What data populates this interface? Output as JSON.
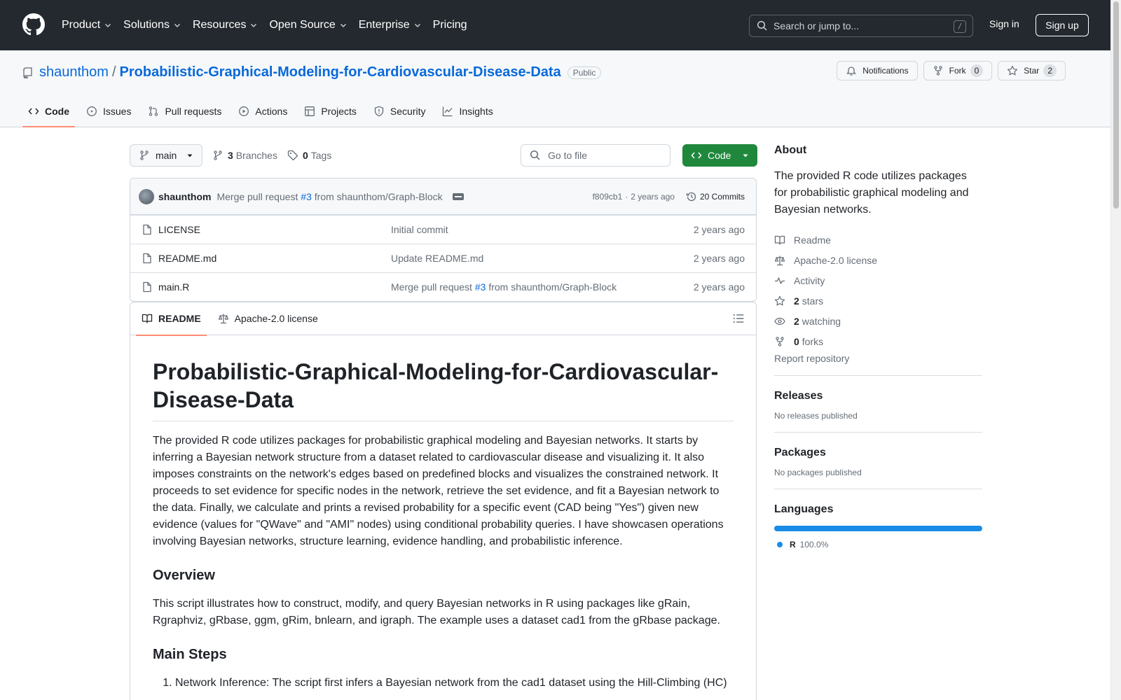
{
  "header": {
    "nav": [
      "Product",
      "Solutions",
      "Resources",
      "Open Source",
      "Enterprise",
      "Pricing"
    ],
    "search_placeholder": "Search or jump to...",
    "search_shortcut": "/",
    "sign_in": "Sign in",
    "sign_up": "Sign up"
  },
  "repo": {
    "owner": "shaunthom",
    "separator": "/",
    "name": "Probabilistic-Graphical-Modeling-for-Cardiovascular-Disease-Data",
    "visibility": "Public",
    "notifications_label": "Notifications",
    "fork_label": "Fork",
    "fork_count": "0",
    "star_label": "Star",
    "star_count": "2",
    "tabs": [
      "Code",
      "Issues",
      "Pull requests",
      "Actions",
      "Projects",
      "Security",
      "Insights"
    ]
  },
  "filebar": {
    "branch": "main",
    "branches_count": "3",
    "branches_label": "Branches",
    "tags_count": "0",
    "tags_label": "Tags",
    "goto_placeholder": "Go to file",
    "code_label": "Code"
  },
  "commit": {
    "author": "shaunthom",
    "message_prefix": "Merge pull request",
    "pr_link": "#3",
    "message_suffix": "from shaunthom/Graph-Block",
    "hash": "f809cb1",
    "dot": "·",
    "age": "2 years ago",
    "commits_label": "20 Commits"
  },
  "files": [
    {
      "name": "LICENSE",
      "msg_prefix": "Initial commit",
      "msg_link": "",
      "msg_suffix": "",
      "age": "2 years ago"
    },
    {
      "name": "README.md",
      "msg_prefix": "Update README.md",
      "msg_link": "",
      "msg_suffix": "",
      "age": "2 years ago"
    },
    {
      "name": "main.R",
      "msg_prefix": "Merge pull request",
      "msg_link": "#3",
      "msg_suffix": "from shaunthom/Graph-Block",
      "age": "2 years ago"
    }
  ],
  "readme": {
    "tab_readme": "README",
    "tab_license": "Apache-2.0 license",
    "title": "Probabilistic-Graphical-Modeling-for-Cardiovascular-Disease-Data",
    "intro": "The provided R code utilizes packages for probabilistic graphical modeling and Bayesian networks. It starts by inferring a Bayesian network structure from a dataset related to cardiovascular disease and visualizing it. It also imposes constraints on the network's edges based on predefined blocks and visualizes the constrained network. It proceeds to set evidence for specific nodes in the network, retrieve the set evidence, and fit a Bayesian network to the data. Finally, we calculate and prints a revised probability for a specific event (CAD being \"Yes\") given new evidence (values for \"QWave\" and \"AMI\" nodes) using conditional probability queries. I have showcasen operations involving Bayesian networks, structure learning, evidence handling, and probabilistic inference.",
    "overview_heading": "Overview",
    "overview_text": "This script illustrates how to construct, modify, and query Bayesian networks in R using packages like gRain, Rgraphviz, gRbase, ggm, gRim, bnlearn, and igraph. The example uses a dataset cad1 from the gRbase package.",
    "steps_heading": "Main Steps",
    "step1": "Network Inference: The script first infers a Bayesian network from the cad1 dataset using the Hill-Climbing (HC)"
  },
  "about": {
    "heading": "About",
    "description": "The provided R code utilizes packages for probabilistic graphical modeling and Bayesian networks.",
    "readme": "Readme",
    "license": "Apache-2.0 license",
    "activity": "Activity",
    "stars_count": "2",
    "stars_label": "stars",
    "watching_count": "2",
    "watching_label": "watching",
    "forks_count": "0",
    "forks_label": "forks",
    "report": "Report repository"
  },
  "releases": {
    "heading": "Releases",
    "empty": "No releases published"
  },
  "packages": {
    "heading": "Packages",
    "empty": "No packages published"
  },
  "languages": {
    "heading": "Languages",
    "items": [
      {
        "name": "R",
        "percent": "100.0%",
        "color": "#198CE7",
        "fraction": 1.0
      }
    ]
  },
  "colors": {
    "header_bg": "#24292f",
    "link": "#0969da",
    "code_button": "#1f883d",
    "tab_underline": "#fd8c73"
  }
}
